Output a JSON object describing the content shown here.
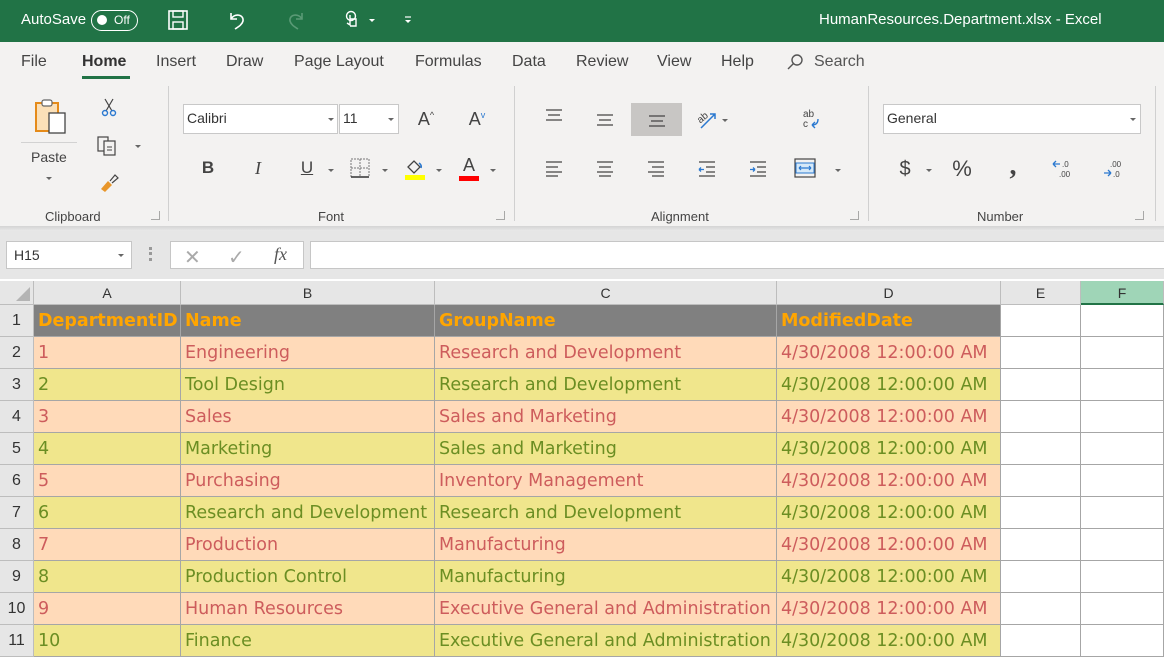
{
  "titlebar": {
    "autosave_label": "AutoSave",
    "autosave_state": "Off",
    "file_title": "HumanResources.Department.xlsx  -  Excel"
  },
  "menu": {
    "tabs": [
      "File",
      "Home",
      "Insert",
      "Draw",
      "Page Layout",
      "Formulas",
      "Data",
      "Review",
      "View",
      "Help"
    ],
    "active_tab": "Home",
    "search_label": "Search"
  },
  "ribbon": {
    "clipboard": {
      "label": "Clipboard",
      "paste_label": "Paste"
    },
    "font": {
      "label": "Font",
      "font_name": "Calibri",
      "font_size": "11",
      "bold": "B",
      "italic": "I",
      "underline": "U",
      "font_color_glyph": "A",
      "highlight_color": "#ffff00",
      "font_color": "#ff0000"
    },
    "alignment": {
      "label": "Alignment"
    },
    "number": {
      "label": "Number",
      "format": "General",
      "currency": "$",
      "percent": "%",
      "comma": ","
    }
  },
  "formula_bar": {
    "name_box": "H15",
    "fx_label": "fx",
    "value": ""
  },
  "sheet": {
    "columns": [
      "A",
      "B",
      "C",
      "D",
      "E",
      "F"
    ],
    "selected_column": "F",
    "rows": [
      {
        "num": "1",
        "cells": [
          "DepartmentID",
          "Name",
          "GroupName",
          "ModifiedDate"
        ],
        "style": "header"
      },
      {
        "num": "2",
        "cells": [
          "1",
          "Engineering",
          "Research and Development",
          "4/30/2008 12:00:00 AM"
        ],
        "style": "odd"
      },
      {
        "num": "3",
        "cells": [
          "2",
          "Tool Design",
          "Research and Development",
          "4/30/2008 12:00:00 AM"
        ],
        "style": "even"
      },
      {
        "num": "4",
        "cells": [
          "3",
          "Sales",
          "Sales and Marketing",
          "4/30/2008 12:00:00 AM"
        ],
        "style": "odd"
      },
      {
        "num": "5",
        "cells": [
          "4",
          "Marketing",
          "Sales and Marketing",
          "4/30/2008 12:00:00 AM"
        ],
        "style": "even"
      },
      {
        "num": "6",
        "cells": [
          "5",
          "Purchasing",
          "Inventory Management",
          "4/30/2008 12:00:00 AM"
        ],
        "style": "odd"
      },
      {
        "num": "7",
        "cells": [
          "6",
          "Research and Development",
          "Research and Development",
          "4/30/2008 12:00:00 AM"
        ],
        "style": "even"
      },
      {
        "num": "8",
        "cells": [
          "7",
          "Production",
          "Manufacturing",
          "4/30/2008 12:00:00 AM"
        ],
        "style": "odd"
      },
      {
        "num": "9",
        "cells": [
          "8",
          "Production Control",
          "Manufacturing",
          "4/30/2008 12:00:00 AM"
        ],
        "style": "even"
      },
      {
        "num": "10",
        "cells": [
          "9",
          "Human Resources",
          "Executive General and Administration",
          "4/30/2008 12:00:00 AM"
        ],
        "style": "odd"
      },
      {
        "num": "11",
        "cells": [
          "10",
          "Finance",
          "Executive General and Administration",
          "4/30/2008 12:00:00 AM"
        ],
        "style": "even"
      }
    ],
    "colors": {
      "header_bg": "#808080",
      "header_text": "#ffa500",
      "odd_bg": "#ffdab9",
      "odd_text": "#cd5c5c",
      "even_bg": "#f0e68c",
      "even_text": "#6b8e23",
      "accent": "#217346"
    }
  }
}
